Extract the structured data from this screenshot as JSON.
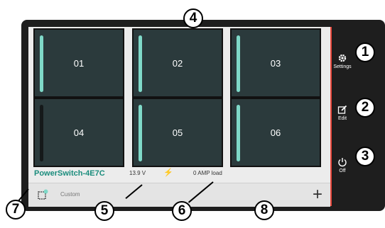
{
  "tiles": [
    {
      "label": "01",
      "on": true
    },
    {
      "label": "02",
      "on": true
    },
    {
      "label": "03",
      "on": true
    },
    {
      "label": "04",
      "on": false
    },
    {
      "label": "05",
      "on": true
    },
    {
      "label": "06",
      "on": true
    }
  ],
  "status": {
    "device_name": "PowerSwitch-4E7C",
    "voltage": "13.9 V",
    "load": "0 AMP load"
  },
  "profile": {
    "label": "Custom"
  },
  "sidebar": {
    "settings_label": "Settings",
    "edit_label": "Edit",
    "off_label": "Off"
  },
  "callouts": [
    "1",
    "2",
    "3",
    "4",
    "5",
    "6",
    "7",
    "8"
  ],
  "colors": {
    "tile_bg": "#2b3a3c",
    "tile_bar_on": "#7fd9c8",
    "accent": "#1a8c7c",
    "edge": "#e8473b"
  }
}
